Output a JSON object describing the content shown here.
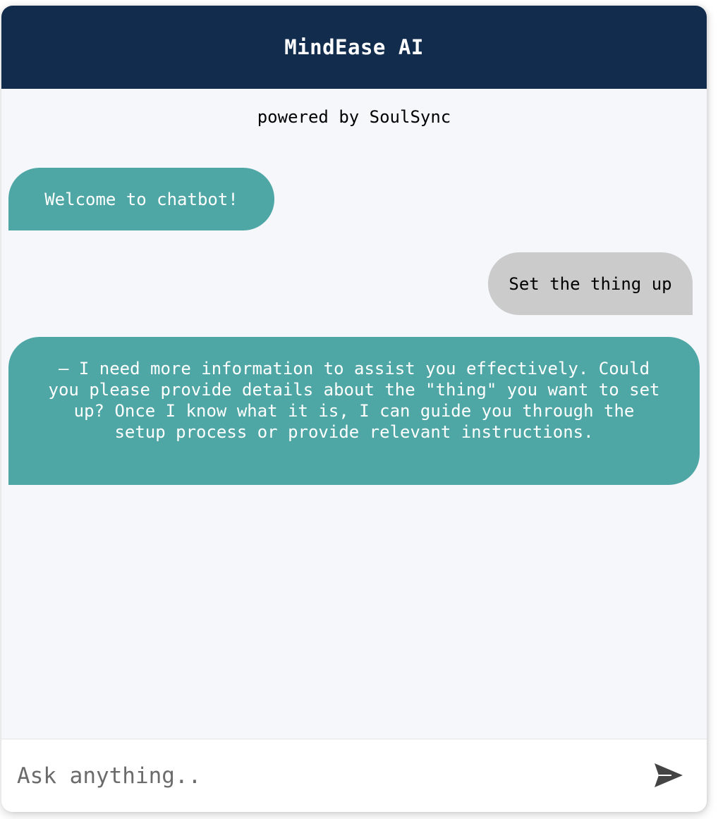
{
  "header": {
    "title": "MindEase AI",
    "subtitle": "powered by SoulSync"
  },
  "messages": [
    {
      "role": "bot",
      "text": "Welcome to chatbot!"
    },
    {
      "role": "user",
      "text": "Set the thing up"
    },
    {
      "role": "bot",
      "text": "— I need more information to assist you effectively. Could you please provide details about the \"thing\" you want to set up? Once I know what it is, I can guide you through the setup process or provide relevant instructions."
    }
  ],
  "composer": {
    "placeholder": "Ask anything..",
    "send_icon": "send-icon"
  },
  "colors": {
    "header_bg": "#112c4d",
    "bot_bubble": "#4ea7a5",
    "user_bubble": "#cbcbcb",
    "chat_bg": "#f6f7fb"
  }
}
